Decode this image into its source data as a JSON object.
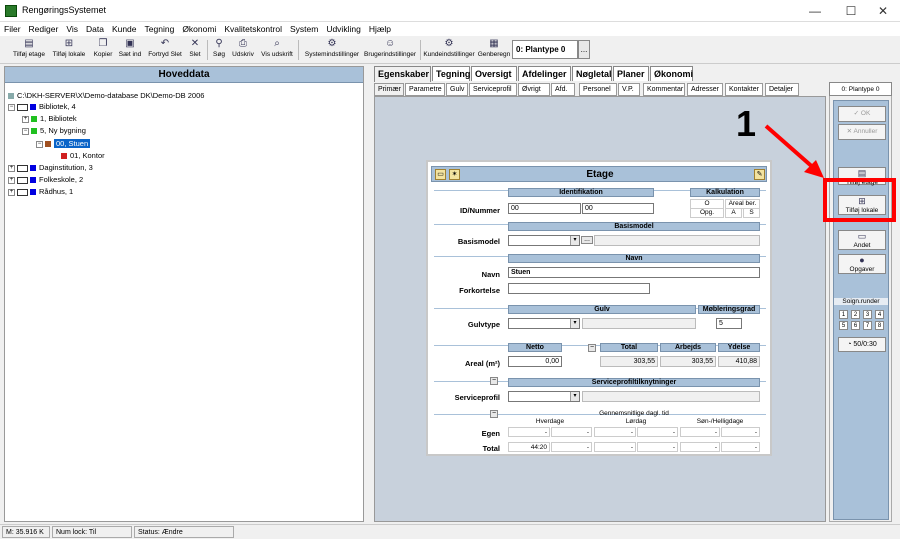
{
  "window": {
    "title": "RengøringsSystemet",
    "minimize": "—",
    "maximize": "☐",
    "close": "✕"
  },
  "menu": [
    "Filer",
    "Rediger",
    "Vis",
    "Data",
    "Kunde",
    "Tegning",
    "Økonomi",
    "Kvalitetskontrol",
    "System",
    "Udvikling",
    "Hjælp"
  ],
  "toolbar": {
    "tilfoj_etage": "Tilføj etage",
    "tilfoj_lokale": "Tilføj lokale",
    "kopier": "Kopier",
    "saet_ind": "Sæt ind",
    "fortryd_slet": "Fortryd Slet",
    "slet": "Slet",
    "sog": "Søg",
    "udskriv": "Udskriv",
    "vis_udskrift": "Vis udskrift",
    "systemindstillinger": "Systemindstillinger",
    "brugerindstillinger": "Brugerindstillinger",
    "kundeindstillinger": "Kundeindstillinger",
    "genberegn": "Genberegn",
    "plantype": "0: Plantype 0",
    "more": "..."
  },
  "left": {
    "header": "Hoveddata",
    "path": "C:\\DKH-SERVER\\X\\Demo-database DK\\Demo-DB 2006",
    "tree": [
      {
        "label": "Bibliotek, 4",
        "toggle": "−"
      },
      {
        "label": "1, Bibliotek",
        "toggle": "+"
      },
      {
        "label": "5, Ny bygning",
        "toggle": "−"
      },
      {
        "label": "00, Stuen",
        "toggle": "−"
      },
      {
        "label": "01, Kontor",
        "toggle": ""
      },
      {
        "label": "Daginstitution, 3",
        "toggle": "+"
      },
      {
        "label": "Folkeskole, 2",
        "toggle": "+"
      },
      {
        "label": "Rådhus, 1",
        "toggle": "+"
      }
    ]
  },
  "tabs": [
    "Egenskaber",
    "Tegning",
    "Oversigt",
    "Afdelinger",
    "Nøgletal",
    "Planer",
    "Økonomi"
  ],
  "subtabs": [
    "Primær",
    "Parametre",
    "Gulv",
    "Serviceprofil",
    "Øvrigt",
    "Afd.",
    "Personel",
    "V.P.",
    "Kommentar",
    "Adresser",
    "Kontakter",
    "Detaljer"
  ],
  "form": {
    "title": "Etage",
    "identifikation": "Identifikation",
    "kalkulation": "Kalkulation",
    "kal_o": "O",
    "kal_areal": "Areal ber.",
    "kal_opg": "Opg.",
    "kal_a": "A",
    "kal_s": "S",
    "id_label": "ID/Nummer",
    "id1": "00",
    "id2": "00",
    "basismodel_head": "Basismodel",
    "basismodel_label": "Basismodel",
    "basis_more": "...",
    "navn_head": "Navn",
    "navn_label": "Navn",
    "navn_value": "Stuen",
    "forkortelse_label": "Forkortelse",
    "gulv_head": "Gulv",
    "mobleringsgrad_head": "Møbleringsgrad",
    "gulvtype_label": "Gulvtype",
    "mobleringsgrad": "5",
    "netto_head": "Netto",
    "total_head": "Total",
    "arbejds_head": "Arbejds",
    "ydelse_head": "Ydelse",
    "areal_label": "Areal (m²)",
    "netto": "0,00",
    "total": "303,55",
    "arbejds": "303,55",
    "ydelse": "410,88",
    "serviceprofil_head": "Serviceprofiltilknytninger",
    "serviceprofil_label": "Serviceprofil",
    "gennemsnit": "Gennemsnitlige dagl. tid",
    "hverdage": "Hverdage",
    "lordag": "Lørdag",
    "sonhellig": "Søn-/Helligdage",
    "egen_label": "Egen",
    "total_label": "Total",
    "egen_vals": [
      "-",
      "-",
      "-",
      "-",
      "-",
      "-"
    ],
    "total_vals": [
      "44:20",
      "-",
      "-",
      "-",
      "-",
      "-"
    ],
    "minus": "−",
    "dd": "▾",
    "spin": "▴▾"
  },
  "right": {
    "plantype": "0: Plantype 0",
    "ok": "OK",
    "annuller": "Annuller",
    "tilfoj_etage": "Tilføj etage",
    "tilfoj_lokale": "Tilføj lokale",
    "andet": "Andet",
    "opgaver": "Opgaver",
    "soign": "Soign.runder",
    "nums": [
      "1",
      "2",
      "3",
      "4",
      "5",
      "6",
      "7",
      "8"
    ],
    "counter": "50/0:30"
  },
  "annotation": "1",
  "status": {
    "mem": "M: 35.916 K",
    "numlock": "Num lock: Til",
    "status": "Status: Ændre"
  }
}
